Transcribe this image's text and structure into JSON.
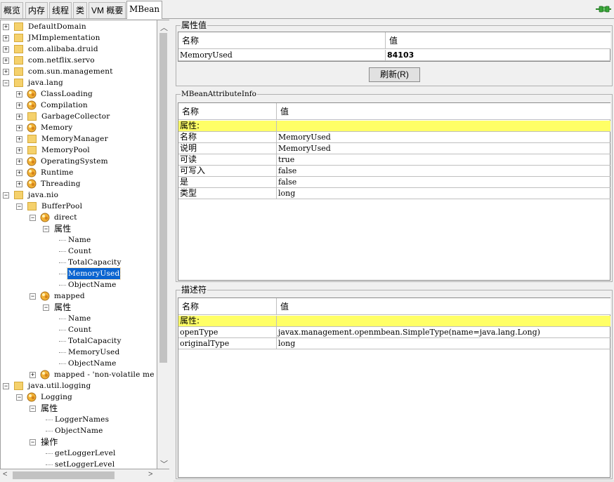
{
  "tabs": [
    {
      "label": "概览",
      "active": false
    },
    {
      "label": "内存",
      "active": false
    },
    {
      "label": "线程",
      "active": false
    },
    {
      "label": "类",
      "active": false
    },
    {
      "label": "VM 概要",
      "active": false
    },
    {
      "label": "MBean",
      "active": true
    }
  ],
  "tree": [
    {
      "label": "DefaultDomain",
      "level": 0,
      "expander": "+",
      "icon": "folder"
    },
    {
      "label": "JMImplementation",
      "level": 0,
      "expander": "+",
      "icon": "folder"
    },
    {
      "label": "com.alibaba.druid",
      "level": 0,
      "expander": "+",
      "icon": "folder"
    },
    {
      "label": "com.netflix.servo",
      "level": 0,
      "expander": "+",
      "icon": "folder"
    },
    {
      "label": "com.sun.management",
      "level": 0,
      "expander": "+",
      "icon": "folder"
    },
    {
      "label": "java.lang",
      "level": 0,
      "expander": "-",
      "icon": "folder"
    },
    {
      "label": "ClassLoading",
      "level": 1,
      "expander": "+",
      "icon": "bean"
    },
    {
      "label": "Compilation",
      "level": 1,
      "expander": "+",
      "icon": "bean"
    },
    {
      "label": "GarbageCollector",
      "level": 1,
      "expander": "+",
      "icon": "folder"
    },
    {
      "label": "Memory",
      "level": 1,
      "expander": "+",
      "icon": "bean"
    },
    {
      "label": "MemoryManager",
      "level": 1,
      "expander": "+",
      "icon": "folder"
    },
    {
      "label": "MemoryPool",
      "level": 1,
      "expander": "+",
      "icon": "folder"
    },
    {
      "label": "OperatingSystem",
      "level": 1,
      "expander": "+",
      "icon": "bean"
    },
    {
      "label": "Runtime",
      "level": 1,
      "expander": "+",
      "icon": "bean"
    },
    {
      "label": "Threading",
      "level": 1,
      "expander": "+",
      "icon": "bean"
    },
    {
      "label": "java.nio",
      "level": 0,
      "expander": "-",
      "icon": "folder"
    },
    {
      "label": "BufferPool",
      "level": 1,
      "expander": "-",
      "icon": "folder"
    },
    {
      "label": "direct",
      "level": 2,
      "expander": "-",
      "icon": "bean"
    },
    {
      "label": "属性",
      "level": 3,
      "expander": "-",
      "icon": "none"
    },
    {
      "label": "Name",
      "level": 4,
      "expander": "",
      "icon": "none"
    },
    {
      "label": "Count",
      "level": 4,
      "expander": "",
      "icon": "none"
    },
    {
      "label": "TotalCapacity",
      "level": 4,
      "expander": "",
      "icon": "none"
    },
    {
      "label": "MemoryUsed",
      "level": 4,
      "expander": "",
      "icon": "none",
      "selected": true
    },
    {
      "label": "ObjectName",
      "level": 4,
      "expander": "",
      "icon": "none"
    },
    {
      "label": "mapped",
      "level": 2,
      "expander": "-",
      "icon": "bean"
    },
    {
      "label": "属性",
      "level": 3,
      "expander": "-",
      "icon": "none"
    },
    {
      "label": "Name",
      "level": 4,
      "expander": "",
      "icon": "none"
    },
    {
      "label": "Count",
      "level": 4,
      "expander": "",
      "icon": "none"
    },
    {
      "label": "TotalCapacity",
      "level": 4,
      "expander": "",
      "icon": "none"
    },
    {
      "label": "MemoryUsed",
      "level": 4,
      "expander": "",
      "icon": "none"
    },
    {
      "label": "ObjectName",
      "level": 4,
      "expander": "",
      "icon": "none"
    },
    {
      "label": "mapped - 'non-volatile me",
      "level": 2,
      "expander": "+",
      "icon": "bean"
    },
    {
      "label": "java.util.logging",
      "level": 0,
      "expander": "-",
      "icon": "folder"
    },
    {
      "label": "Logging",
      "level": 1,
      "expander": "-",
      "icon": "bean"
    },
    {
      "label": "属性",
      "level": 2,
      "expander": "-",
      "icon": "none"
    },
    {
      "label": "LoggerNames",
      "level": 3,
      "expander": "",
      "icon": "none"
    },
    {
      "label": "ObjectName",
      "level": 3,
      "expander": "",
      "icon": "none"
    },
    {
      "label": "操作",
      "level": 2,
      "expander": "-",
      "icon": "none"
    },
    {
      "label": "getLoggerLevel",
      "level": 3,
      "expander": "",
      "icon": "none"
    },
    {
      "label": "setLoggerLevel",
      "level": 3,
      "expander": "",
      "icon": "none"
    }
  ],
  "attr_values": {
    "title": "属性值",
    "col_name": "名称",
    "col_value": "值",
    "row_name": "MemoryUsed",
    "row_value": "84103",
    "refresh_label": "刷新(R)"
  },
  "attr_info": {
    "title": "MBeanAttributeInfo",
    "col_name": "名称",
    "col_value": "值",
    "section": "属性:",
    "rows": [
      {
        "name": "名称",
        "value": "MemoryUsed"
      },
      {
        "name": "说明",
        "value": "MemoryUsed"
      },
      {
        "name": "可读",
        "value": "true"
      },
      {
        "name": "可写入",
        "value": "false"
      },
      {
        "name": "是",
        "value": "false"
      },
      {
        "name": "类型",
        "value": "long"
      }
    ]
  },
  "descriptor": {
    "title": "描述符",
    "col_name": "名称",
    "col_value": "值",
    "section": "属性:",
    "rows": [
      {
        "name": "openType",
        "value": "javax.management.openmbean.SimpleType(name=java.lang.Long)"
      },
      {
        "name": "originalType",
        "value": "long"
      }
    ]
  },
  "icons": {
    "connection": "connection-plug-icon",
    "folder": "folder-icon",
    "bean": "mbean-icon"
  },
  "colors": {
    "selection": "#0a64d0",
    "section_highlight": "#ffff66",
    "folder": "#f5d16c"
  }
}
